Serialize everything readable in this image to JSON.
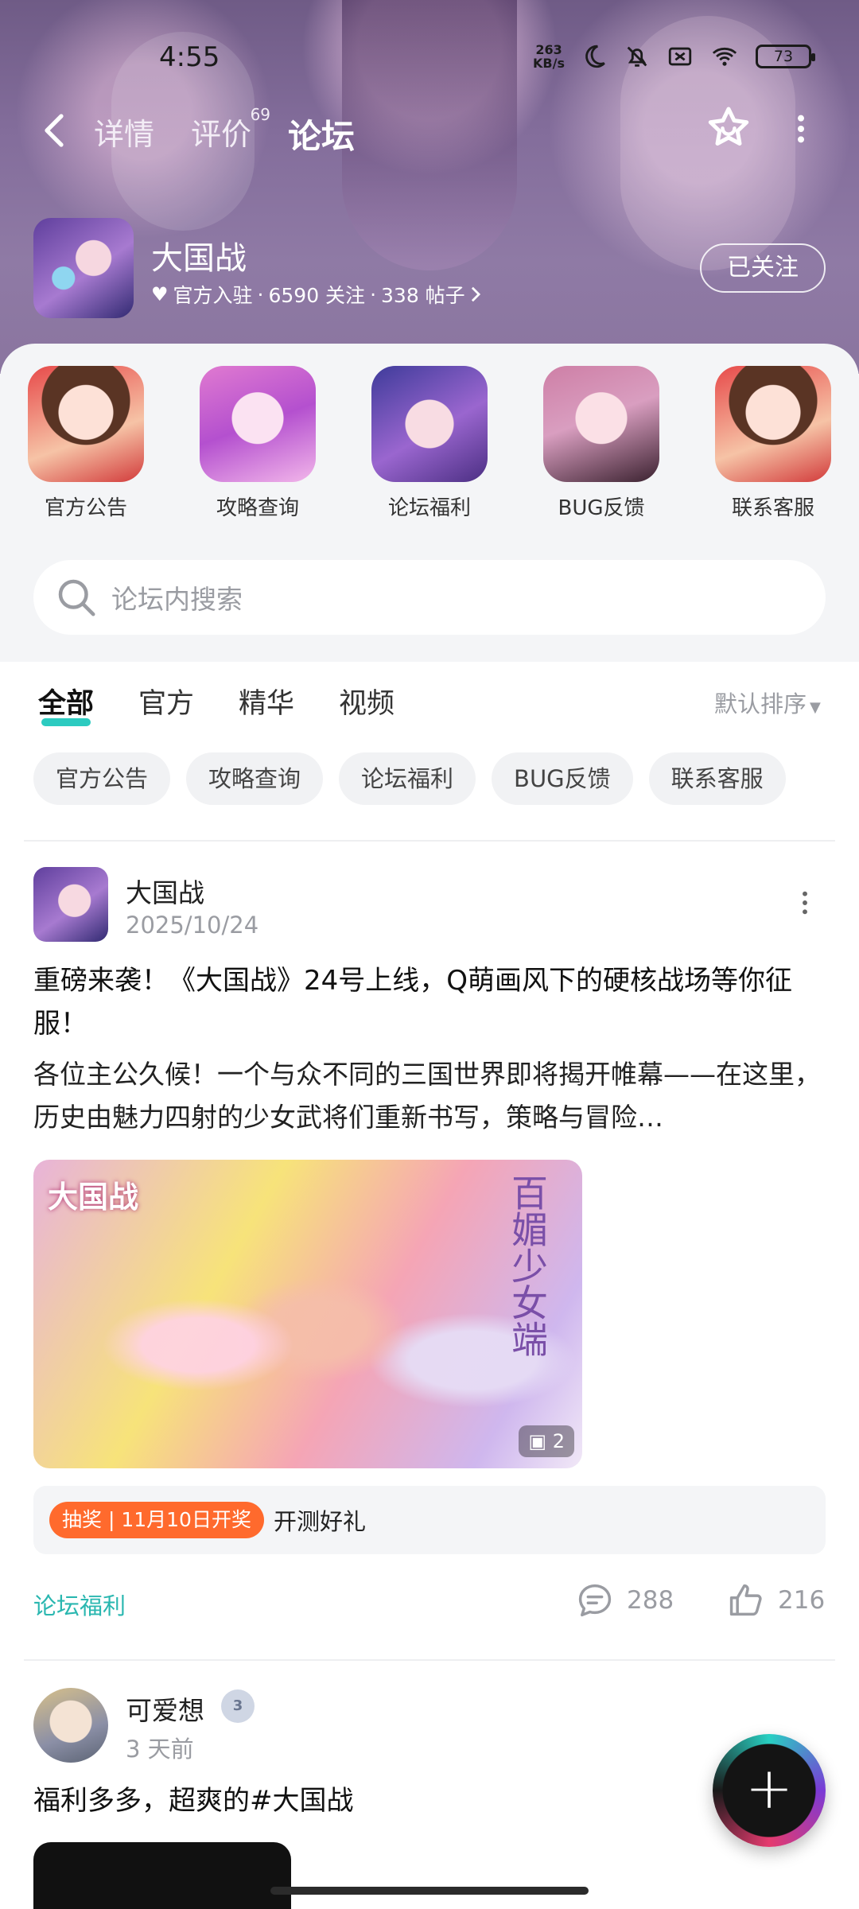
{
  "status_bar": {
    "time": "4:55",
    "net_speed_value": "263",
    "net_speed_unit": "KB/s",
    "battery": "73"
  },
  "nav": {
    "tabs": [
      {
        "label": "详情"
      },
      {
        "label": "评价",
        "badge": "69"
      },
      {
        "label": "论坛",
        "active": true
      }
    ]
  },
  "forum": {
    "name": "大国战",
    "official": "官方入驻",
    "followers": "6590 关注",
    "posts": "338 帖子",
    "separator": "·",
    "follow_label": "已关注"
  },
  "categories": [
    {
      "label": "官方公告"
    },
    {
      "label": "攻略查询"
    },
    {
      "label": "论坛福利"
    },
    {
      "label": "BUG反馈"
    },
    {
      "label": "联系客服"
    }
  ],
  "search": {
    "placeholder": "论坛内搜索"
  },
  "filter_tabs": [
    "全部",
    "官方",
    "精华",
    "视频"
  ],
  "sort_label": "默认排序",
  "chips": [
    "官方公告",
    "攻略查询",
    "论坛福利",
    "BUG反馈",
    "联系客服"
  ],
  "posts": [
    {
      "author": "大国战",
      "date": "2025/10/24",
      "title": "重磅来袭！《大国战》24号上线，Q萌画风下的硬核战场等你征服！",
      "body": "各位主公久候！一个与众不同的三国世界即将揭开帷幕——在这里，历史由魅力四射的少女武将们重新书写，策略与冒险…",
      "image_overlay_text": "大国战",
      "image_side_text": "百媚少女端",
      "image_count": "2",
      "lottery_tag": "抽奖 | 11月10日开奖",
      "lottery_text": "开测好礼",
      "category": "论坛福利",
      "comments": "288",
      "likes": "216"
    },
    {
      "author": "可爱想",
      "level_badge": "3",
      "time": "3 天前",
      "body": "福利多多，超爽的#大国战"
    }
  ],
  "colors": {
    "accent": "#2ccbc0",
    "lottery_tag": "#ff6a2d",
    "category_link": "#2ab7b0"
  }
}
